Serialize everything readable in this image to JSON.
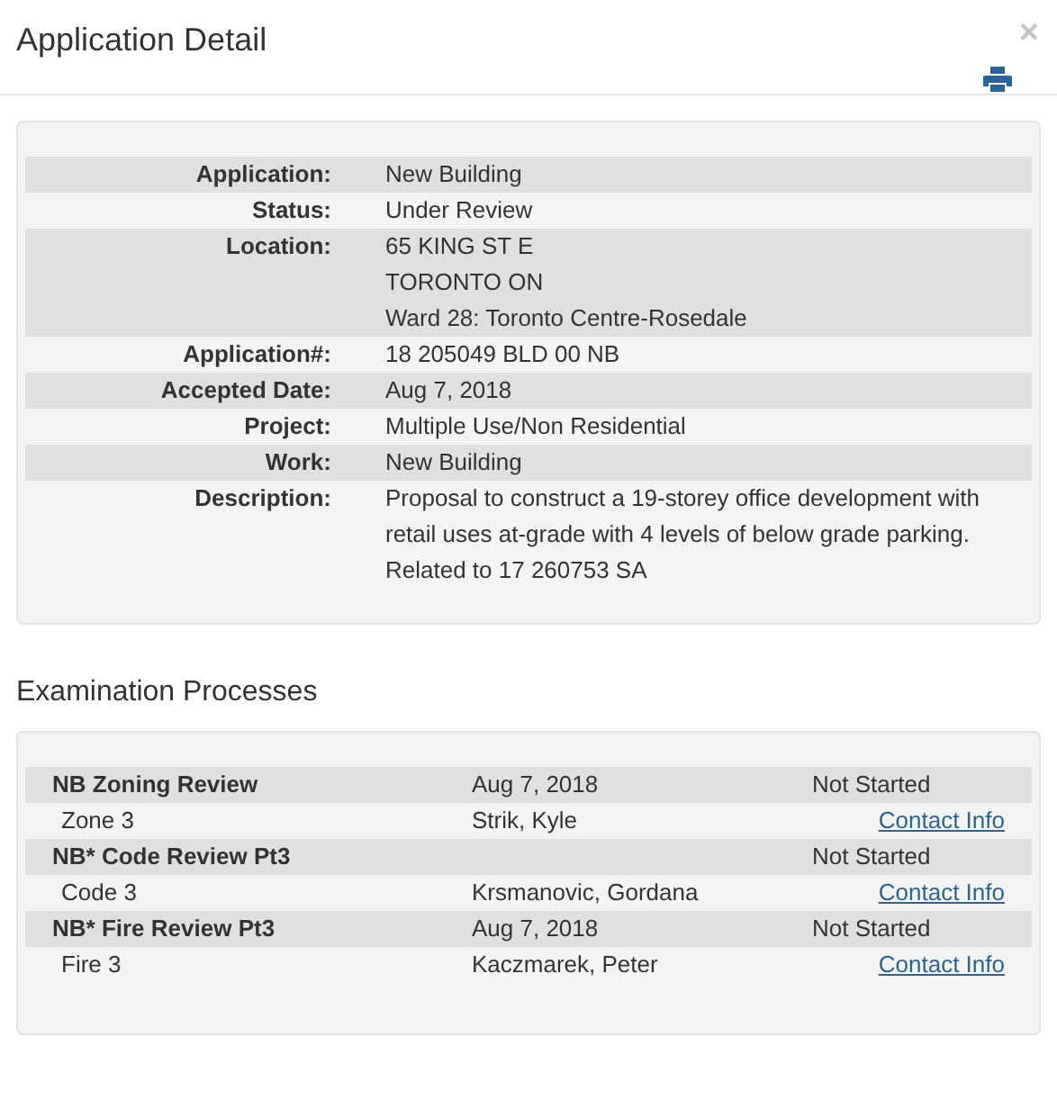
{
  "dialog": {
    "title": "Application Detail",
    "close": "×"
  },
  "details": [
    {
      "label": "Application:",
      "lines": [
        "New Building"
      ]
    },
    {
      "label": "Status:",
      "lines": [
        "Under Review"
      ]
    },
    {
      "label": "Location:",
      "lines": [
        "65 KING ST E",
        "TORONTO ON",
        "Ward 28: Toronto Centre-Rosedale"
      ]
    },
    {
      "label": "Application#:",
      "lines": [
        "18 205049 BLD 00 NB"
      ]
    },
    {
      "label": "Accepted Date:",
      "lines": [
        "Aug 7, 2018"
      ]
    },
    {
      "label": "Project:",
      "lines": [
        "Multiple Use/Non Residential"
      ]
    },
    {
      "label": "Work:",
      "lines": [
        "New Building"
      ]
    },
    {
      "label": "Description:",
      "lines": [
        "Proposal to construct a 19-storey office development with retail uses at-grade with 4 levels of below grade parking. Related to 17 260753 SA"
      ]
    }
  ],
  "examination": {
    "title": "Examination Processes",
    "processes": [
      {
        "name": "NB Zoning Review",
        "date": "Aug 7, 2018",
        "status": "Not Started",
        "area": "Zone 3",
        "examiner": "Strik, Kyle",
        "link": "Contact Info"
      },
      {
        "name": "NB* Code Review Pt3",
        "status": "Not Started",
        "area": "Code 3",
        "examiner": "Krsmanovic, Gordana",
        "link": "Contact Info"
      },
      {
        "name": "NB* Fire Review Pt3",
        "date": "Aug 7, 2018",
        "status": "Not Started",
        "area": "Fire 3",
        "examiner": "Kaczmarek, Peter",
        "link": "Contact Info"
      }
    ]
  }
}
